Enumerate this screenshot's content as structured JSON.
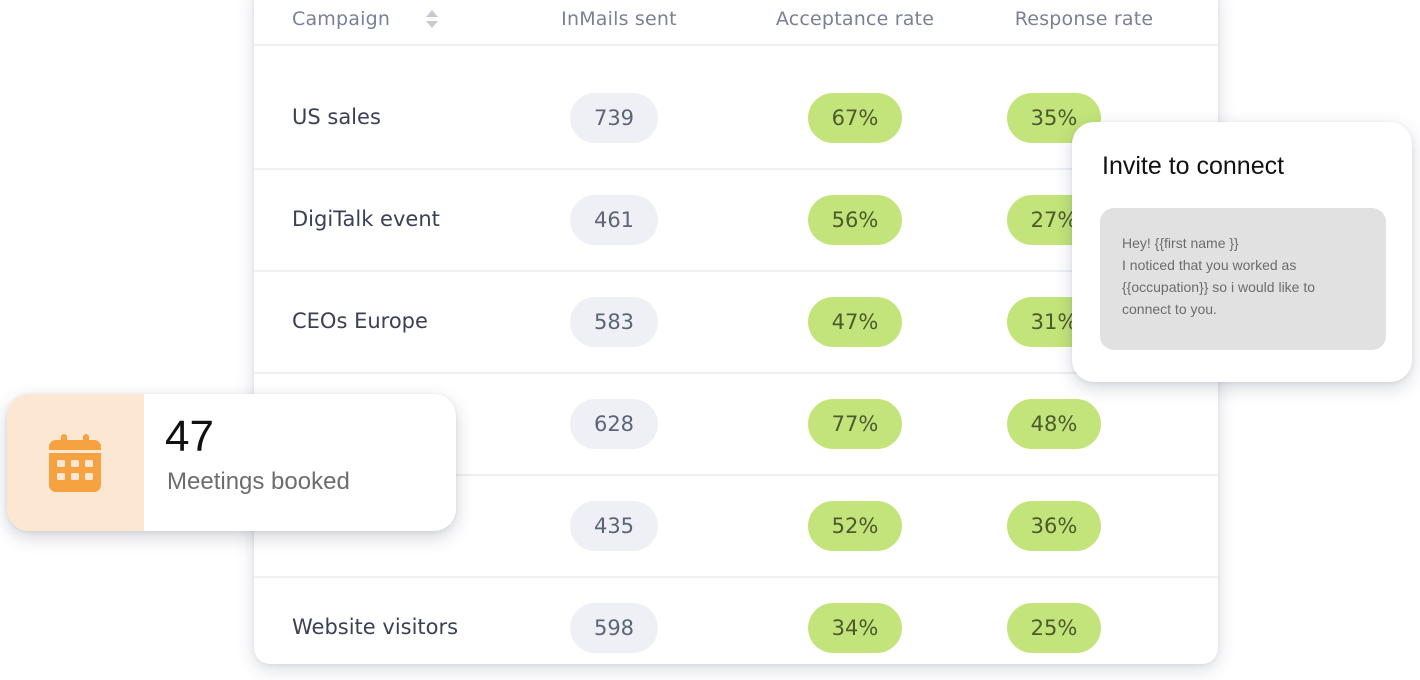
{
  "table": {
    "columns": {
      "campaign": "Campaign",
      "inmails": "InMails sent",
      "acceptance": "Acceptance rate",
      "response": "Response rate"
    },
    "rows": [
      {
        "campaign": "US sales",
        "inmails": "739",
        "acceptance": "67%",
        "response": "35%"
      },
      {
        "campaign": "DigiTalk event",
        "inmails": "461",
        "acceptance": "56%",
        "response": "27%"
      },
      {
        "campaign": "CEOs Europe",
        "inmails": "583",
        "acceptance": "47%",
        "response": "31%"
      },
      {
        "campaign": "",
        "inmails": "628",
        "acceptance": "77%",
        "response": "48%"
      },
      {
        "campaign": "",
        "inmails": "435",
        "acceptance": "52%",
        "response": "36%"
      },
      {
        "campaign": "Website visitors",
        "inmails": "598",
        "acceptance": "34%",
        "response": "25%"
      }
    ]
  },
  "invite": {
    "title": "Invite to connect",
    "message_lines": [
      "Hey! {{first name }}",
      "I noticed that you worked as",
      "{{occupation}} so i would like to",
      "connect to you."
    ]
  },
  "meetings": {
    "value": "47",
    "label": "Meetings booked",
    "icon": "calendar-icon"
  },
  "colors": {
    "pill_green": "#c3e47a",
    "pill_gray": "#eef0f5",
    "calendar_orange": "#f7a240",
    "calendar_bg": "#fbe7d2"
  }
}
